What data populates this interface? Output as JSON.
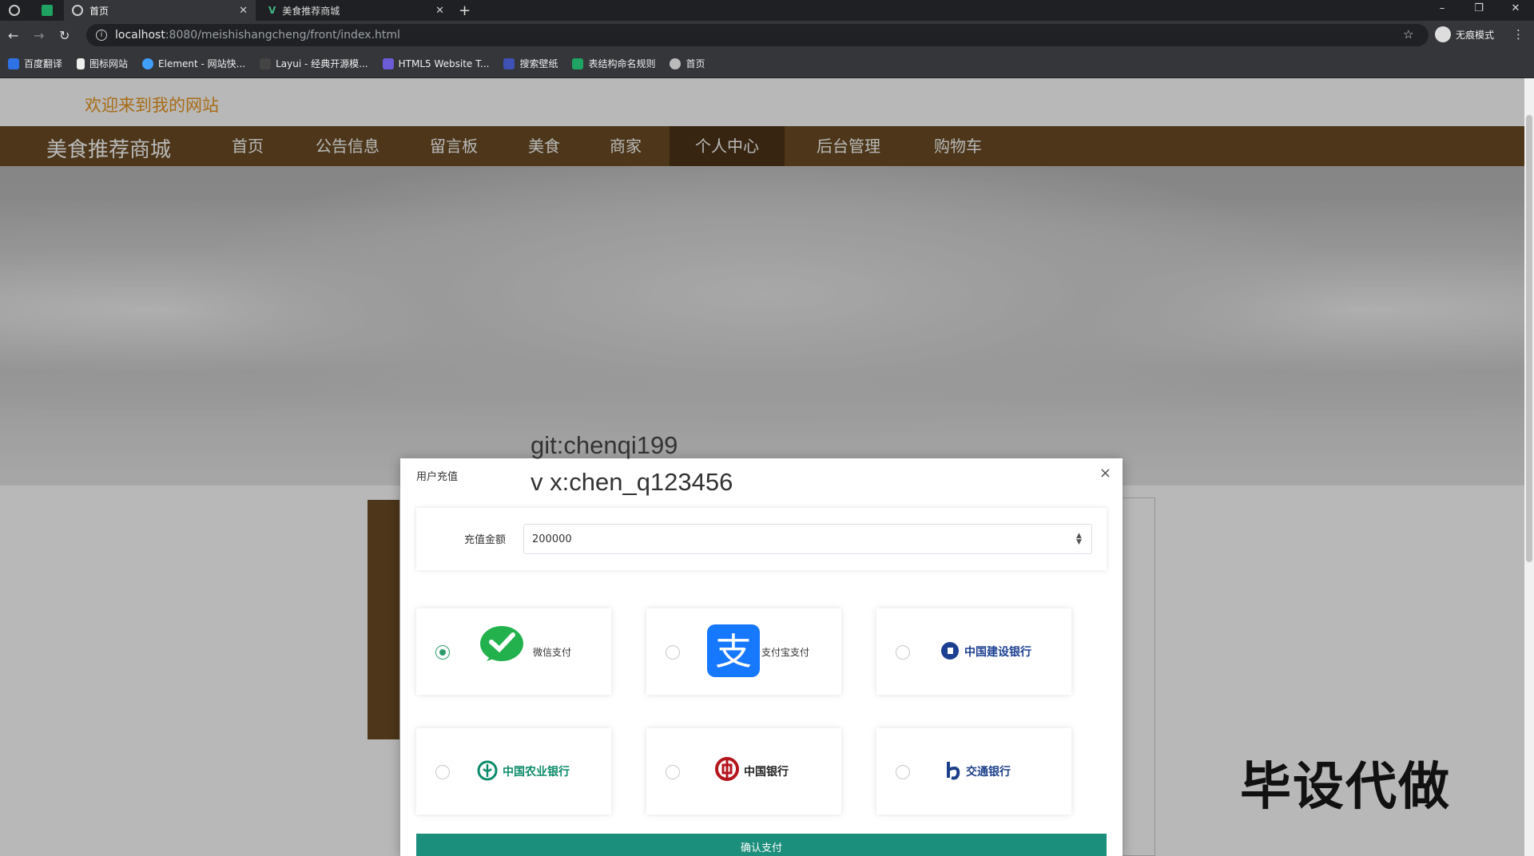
{
  "browser": {
    "tabs": [
      {
        "label": "首页"
      },
      {
        "label": "美食推荐商城"
      }
    ],
    "new_tab": "+",
    "url_host": "localhost",
    "url_path": ":8080/meishishangcheng/front/index.html",
    "incognito_label": "无痕模式",
    "bookmarks": [
      "百度翻译",
      "图标网站",
      "Element - 网站快...",
      "Layui - 经典开源模...",
      "HTML5 Website T...",
      "搜索壁纸",
      "表结构命名规则",
      "首页"
    ]
  },
  "site": {
    "welcome": "欢迎来到我的网站",
    "brand": "美食推荐商城",
    "nav": [
      "首页",
      "公告信息",
      "留言板",
      "美食",
      "商家",
      "个人中心",
      "后台管理",
      "购物车"
    ],
    "active_nav": "个人中心"
  },
  "dialog": {
    "title": "用户充值",
    "close": "×",
    "amount_label": "充值金额",
    "amount_value": "200000",
    "options": [
      {
        "label": "微信支付",
        "checked": true,
        "icon": "wechat-pay-icon",
        "color": "#22b14c"
      },
      {
        "label": "支付宝支付",
        "checked": false,
        "icon": "alipay-icon",
        "color": "#1677ff"
      },
      {
        "label": "中国建设银行",
        "checked": false,
        "icon": "ccb-logo",
        "color": "#1b3f91"
      },
      {
        "label": "中国农业银行",
        "checked": false,
        "icon": "abc-logo",
        "color": "#0b8a69"
      },
      {
        "label": "中国银行",
        "checked": false,
        "icon": "boc-logo",
        "color": "#b4161c"
      },
      {
        "label": "交通银行",
        "checked": false,
        "icon": "bocom-logo",
        "color": "#1c3f8a"
      }
    ],
    "confirm": "确认支付"
  },
  "watermarks": [
    "git:chenqi199",
    "v x:chen_q123456",
    "毕设代做"
  ]
}
